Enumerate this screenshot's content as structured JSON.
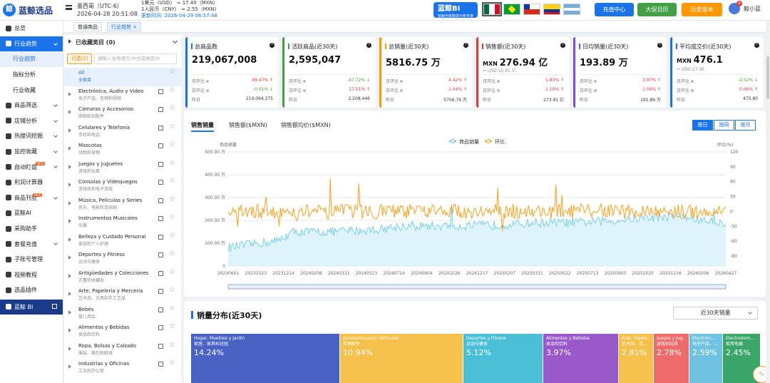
{
  "header": {
    "logo_mark": "鲸",
    "logo_text": "蓝鲸选品",
    "timezone": "墨西哥（UTC-6）",
    "datetime": "2026-04-28 20:51:08",
    "rate_usd": "1美元（USD） ≈   17.40（MXN）",
    "rate_cny": "1人民币（CNY） ≈   2.55（MXN）",
    "updated": "更新时间: 2026-04-29 06:57:48",
    "bi_label": "蓝鲸BI",
    "bi_sub": "蓝鲸全能跨境分析专家",
    "buttons": {
      "recharge": "充值中心",
      "promo": "大促日历",
      "history": "历史版本"
    },
    "user": "鲸小蓝",
    "notif": "8"
  },
  "sidebar": {
    "items": [
      {
        "label": "总览"
      },
      {
        "label": "行业趋势"
      },
      {
        "label": "行业趋势"
      },
      {
        "label": "指标分析"
      },
      {
        "label": "行业收藏"
      },
      {
        "label": "商品筛选"
      },
      {
        "label": "店铺分析"
      },
      {
        "label": "热搜词挖掘"
      },
      {
        "label": "监控收藏"
      },
      {
        "label": "自动盯盘",
        "hot": "NEW"
      },
      {
        "label": "利润计算器"
      },
      {
        "label": "商品刊登",
        "hot": "NEW"
      },
      {
        "label": "蓝鲸AI"
      },
      {
        "label": "采购助手"
      },
      {
        "label": "套餐充值"
      },
      {
        "label": "子账号管理"
      },
      {
        "label": "视频教程"
      },
      {
        "label": "选品插件"
      },
      {
        "label": "蓝鲸 BI"
      }
    ]
  },
  "tabs": [
    {
      "label": "普通商品"
    },
    {
      "label": "行业趋势"
    }
  ],
  "categories": {
    "header": "已收藏类目 (0)",
    "selected_btn": "已选(1)",
    "search_placeholder": "请输入当地语言/中文或类目ID",
    "items": [
      {
        "name": "All",
        "cn": "全类目"
      },
      {
        "name": "Electrónica, Audio y Video",
        "cn": "电子产品、音频和视频"
      },
      {
        "name": "Cámaras y Accesorios",
        "cn": "照相机和配件"
      },
      {
        "name": "Celulares y Telefonía",
        "cn": "手机和电话"
      },
      {
        "name": "Mascotas",
        "cn": "动物和宠物"
      },
      {
        "name": "Juegos y Juguetes",
        "cn": "游戏和玩具"
      },
      {
        "name": "Consolas y Videojuegos",
        "cn": "游戏机和电子游戏"
      },
      {
        "name": "Música, Películas y Series",
        "cn": "音乐、电影和连续剧"
      },
      {
        "name": "Instrumentos Musicales",
        "cn": "乐器"
      },
      {
        "name": "Belleza y Cuidado Personal",
        "cn": "美容和个人护理"
      },
      {
        "name": "Deportes y Fitness",
        "cn": "运动与健身"
      },
      {
        "name": "Antigüedades y Colecciones",
        "cn": "古董和收藏品"
      },
      {
        "name": "Arte, Papelería y Mercería",
        "cn": "艺术品、文具和手工艺品"
      },
      {
        "name": "Bebés",
        "cn": "婴儿用品"
      },
      {
        "name": "Alimentos y Bebidas",
        "cn": "食品和饮料"
      },
      {
        "name": "Ropa, Bolsas y Calzado",
        "cn": "服装、箱包和鞋类"
      },
      {
        "name": "Industrias y Oficinas",
        "cn": "工业和办公室"
      }
    ]
  },
  "kpis": [
    {
      "title": "总商品数",
      "value": "219,067,008",
      "cur": "",
      "sub": "",
      "color": "#1a73e8",
      "rows": [
        {
          "k": "月环比",
          "v": "99.47%",
          "c": "#e53935",
          "arrow": "↑"
        },
        {
          "k": "日环比",
          "v": "-0.01%",
          "c": "#43a047",
          "arrow": "↓"
        },
        {
          "k": "昨日",
          "v": "219,094,375",
          "c": "#333",
          "arrow": ""
        }
      ]
    },
    {
      "title": "活跃商品(近30天)",
      "value": "2,595,047",
      "cur": "",
      "sub": "",
      "color": "#43a047",
      "rows": [
        {
          "k": "月环比",
          "v": "-47.72%",
          "c": "#43a047",
          "arrow": "↓"
        },
        {
          "k": "日环比",
          "v": "17.51%",
          "c": "#e53935",
          "arrow": "↑"
        },
        {
          "k": "昨日",
          "v": "2,208,446",
          "c": "#333",
          "arrow": ""
        }
      ]
    },
    {
      "title": "总销量(近30天)",
      "value": "5816.75 万",
      "cur": "",
      "sub": "",
      "color": "#ff9800",
      "rows": [
        {
          "k": "月环比",
          "v": "4.42%",
          "c": "#e53935",
          "arrow": "↑"
        },
        {
          "k": "日环比",
          "v": "1.04%",
          "c": "#e53935",
          "arrow": "↑"
        },
        {
          "k": "昨日",
          "v": "5756.79 万",
          "c": "#333",
          "arrow": ""
        }
      ]
    },
    {
      "title": "销售额(近30天)",
      "value": "276.94 亿",
      "cur": "MXN",
      "sub": "≈ USD 15.91 亿",
      "color": "#e53935",
      "rows": [
        {
          "k": "月环比",
          "v": "1.83%",
          "c": "#e53935",
          "arrow": "↑"
        },
        {
          "k": "日环比",
          "v": "1.10%",
          "c": "#e53935",
          "arrow": "↑"
        },
        {
          "k": "昨日",
          "v": "273.91 亿",
          "c": "#333",
          "arrow": ""
        }
      ]
    },
    {
      "title": "日均销量(近30天)",
      "value": "193.89 万",
      "cur": "",
      "sub": "",
      "color": "#7b4fd8",
      "rows": [
        {
          "k": "月环比",
          "v": "3.97%",
          "c": "#e53935",
          "arrow": "↑"
        },
        {
          "k": "日环比",
          "v": "1.04%",
          "c": "#e53935",
          "arrow": "↑"
        },
        {
          "k": "昨日",
          "v": "191.89 万",
          "c": "#333",
          "arrow": ""
        }
      ]
    },
    {
      "title": "平均成交价(近30天)",
      "value": "476.1",
      "cur": "MXN",
      "sub": "≈ USD 27.36",
      "color": "#1a73e8",
      "rows": [
        {
          "k": "月环比",
          "v": "-2.52%",
          "c": "#43a047",
          "arrow": "↓"
        },
        {
          "k": "日环比",
          "v": "0.06%",
          "c": "#e53935",
          "arrow": "↑"
        },
        {
          "k": "昨日",
          "v": "475.80",
          "c": "#333",
          "arrow": ""
        }
      ]
    }
  ],
  "chart_tabs": [
    "销售销量",
    "销售额($MXN)",
    "销售额均价($MXN)"
  ],
  "period_buttons": [
    "按日",
    "按周",
    "按月"
  ],
  "chart_data": {
    "type": "line",
    "legend": [
      "商品销量",
      "环比"
    ],
    "left_axis_title": "商品销量",
    "right_axis_title": "环比(%)",
    "y_ticks": [
      "0",
      "100.00 万",
      "200.00 万",
      "300.00 万",
      "400.00 万",
      "500.00 万"
    ],
    "ylim": [
      0,
      500
    ],
    "y2_ticks": [
      "-90",
      "-60",
      "-30",
      "0",
      "30",
      "60",
      "90",
      "120"
    ],
    "y2lim": [
      -90,
      120
    ],
    "x_ticks": [
      "20230601",
      "20231023",
      "20231214",
      "20240208",
      "20240331",
      "20240523",
      "20240714",
      "20240904",
      "20241026",
      "20241217",
      "20250207",
      "20250331",
      "20250522",
      "20250713",
      "20250903",
      "20251025",
      "20251216",
      "20260206",
      "20260427"
    ],
    "series": [
      {
        "name": "商品销量",
        "color": "#5bc8f0",
        "unit": "万",
        "anchors": [
          [
            0,
            80
          ],
          [
            0.06,
            100
          ],
          [
            0.1,
            110
          ],
          [
            0.13,
            150
          ],
          [
            0.2,
            150
          ],
          [
            0.3,
            160
          ],
          [
            0.35,
            175
          ],
          [
            0.45,
            175
          ],
          [
            0.55,
            180
          ],
          [
            0.62,
            190
          ],
          [
            0.7,
            190
          ],
          [
            0.78,
            200
          ],
          [
            0.83,
            210
          ],
          [
            0.9,
            220
          ],
          [
            0.95,
            200
          ],
          [
            1,
            190
          ]
        ]
      },
      {
        "name": "环比",
        "color": "#ff9f1a",
        "unit": "%",
        "base": 0,
        "amp": 15
      }
    ]
  },
  "distribution": {
    "title": "销量分布(近30天)",
    "select": "近30天销量",
    "tiles": [
      {
        "en": "Hogar, Muebles y Jardín",
        "cn": "家居、家具和花园",
        "pct": "14.24%",
        "color": "#4a62c4"
      },
      {
        "en": "Accesorios para Vehículos",
        "cn": "车辆配件",
        "pct": "10.94%",
        "color": "#f6c14a"
      },
      {
        "en": "Deportes y Fitness",
        "cn": "运动与健身",
        "pct": "5.12%",
        "color": "#4bbfd6"
      },
      {
        "en": "Alimentos y Bebidas",
        "cn": "食品和饮料",
        "pct": "3.97%",
        "color": "#9a59c9"
      },
      {
        "en": "Arte, Papele...",
        "cn": "艺术品、文...",
        "pct": "2.81%",
        "color": "#f6c14a"
      },
      {
        "en": "Juegos y Jug...",
        "cn": "游戏和玩具",
        "pct": "2.78%",
        "color": "#ef6b6b"
      },
      {
        "en": "Electróni...",
        "cn": "电子产品、...",
        "pct": "2.59%",
        "color": "#6fc3e0"
      },
      {
        "en": "Electrodom...",
        "cn": "家用电器",
        "pct": "2.45%",
        "color": "#3aa66a"
      }
    ]
  }
}
